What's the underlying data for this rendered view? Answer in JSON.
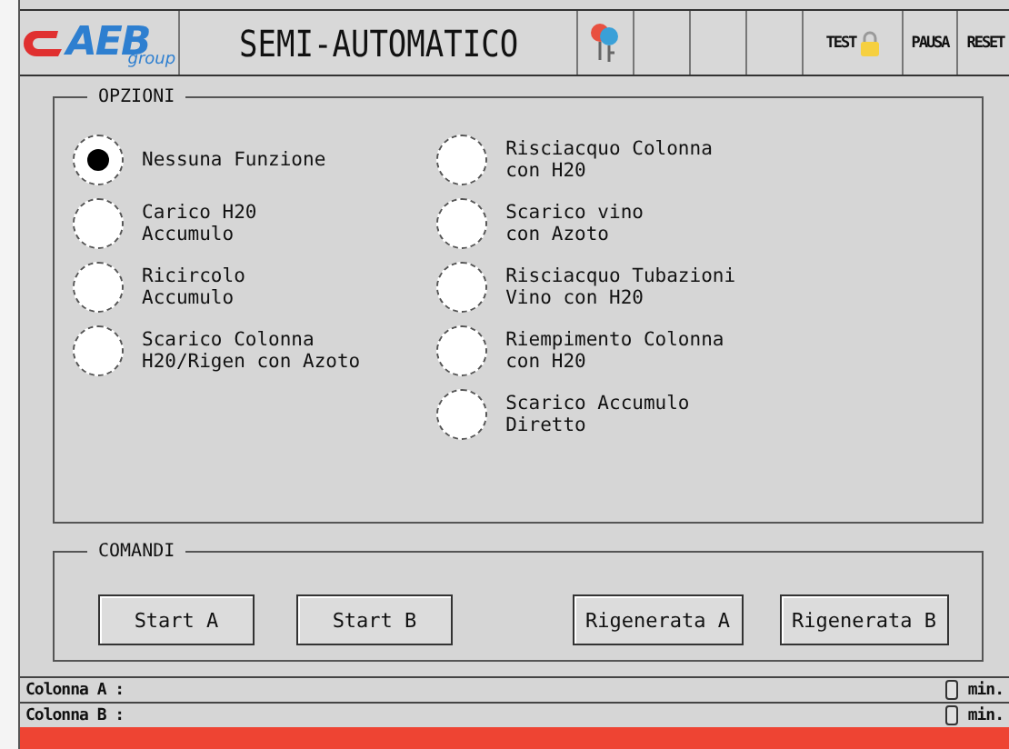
{
  "header": {
    "logo": {
      "brand": "AEB",
      "tagline": "group"
    },
    "title": "SEMI-AUTOMATICO",
    "cells": [
      {
        "kind": "key"
      },
      {
        "kind": "empty"
      },
      {
        "kind": "empty"
      },
      {
        "kind": "empty"
      },
      {
        "kind": "test",
        "label": "TEST"
      },
      {
        "kind": "label",
        "label": "PAUSA"
      },
      {
        "kind": "label",
        "label": "RESET"
      }
    ]
  },
  "options": {
    "title": "OPZIONI",
    "columns": [
      [
        {
          "label": "Nessuna Funzione",
          "selected": true
        },
        {
          "label": "Carico H20\nAccumulo",
          "selected": false
        },
        {
          "label": "Ricircolo\nAccumulo",
          "selected": false
        },
        {
          "label": "Scarico Colonna\nH20/Rigen con Azoto",
          "selected": false
        }
      ],
      [
        {
          "label": "Risciacquo Colonna\ncon H20",
          "selected": false
        },
        {
          "label": "Scarico vino\ncon Azoto",
          "selected": false
        },
        {
          "label": "Risciacquo Tubazioni\nVino con H20",
          "selected": false
        },
        {
          "label": "Riempimento Colonna\ncon H20",
          "selected": false
        },
        {
          "label": "Scarico Accumulo\nDiretto",
          "selected": false
        }
      ]
    ]
  },
  "commands": {
    "title": "COMANDI",
    "groups": [
      [
        "Start A",
        "Start B"
      ],
      [
        "Rigenerata A",
        "Rigenerata B"
      ]
    ]
  },
  "status_rows": [
    {
      "label": "Colonna A :",
      "unit": "min."
    },
    {
      "label": "Colonna B :",
      "unit": "min."
    }
  ]
}
